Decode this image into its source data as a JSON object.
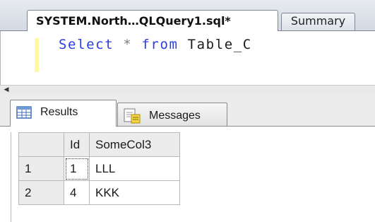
{
  "document_tabs": {
    "active": {
      "title": "SYSTEM.North…QLQuery1.sql*"
    },
    "other": {
      "title": "Summary"
    }
  },
  "editor": {
    "tokens": {
      "kw_select": "Select",
      "star": "*",
      "kw_from": "from",
      "table": "Table_C"
    }
  },
  "results_tabs": {
    "results_label": "Results",
    "messages_label": "Messages",
    "results_icon": "grid-icon",
    "messages_icon": "messages-icon"
  },
  "grid": {
    "columns": [
      "Id",
      "SomeCol3"
    ],
    "rows": [
      {
        "num": "1",
        "cells": [
          "1",
          "LLL"
        ]
      },
      {
        "num": "2",
        "cells": [
          "4",
          "KKK"
        ]
      }
    ]
  },
  "colors": {
    "keyword": "#2b3ee0",
    "gutter_highlight": "#fff8a8"
  }
}
